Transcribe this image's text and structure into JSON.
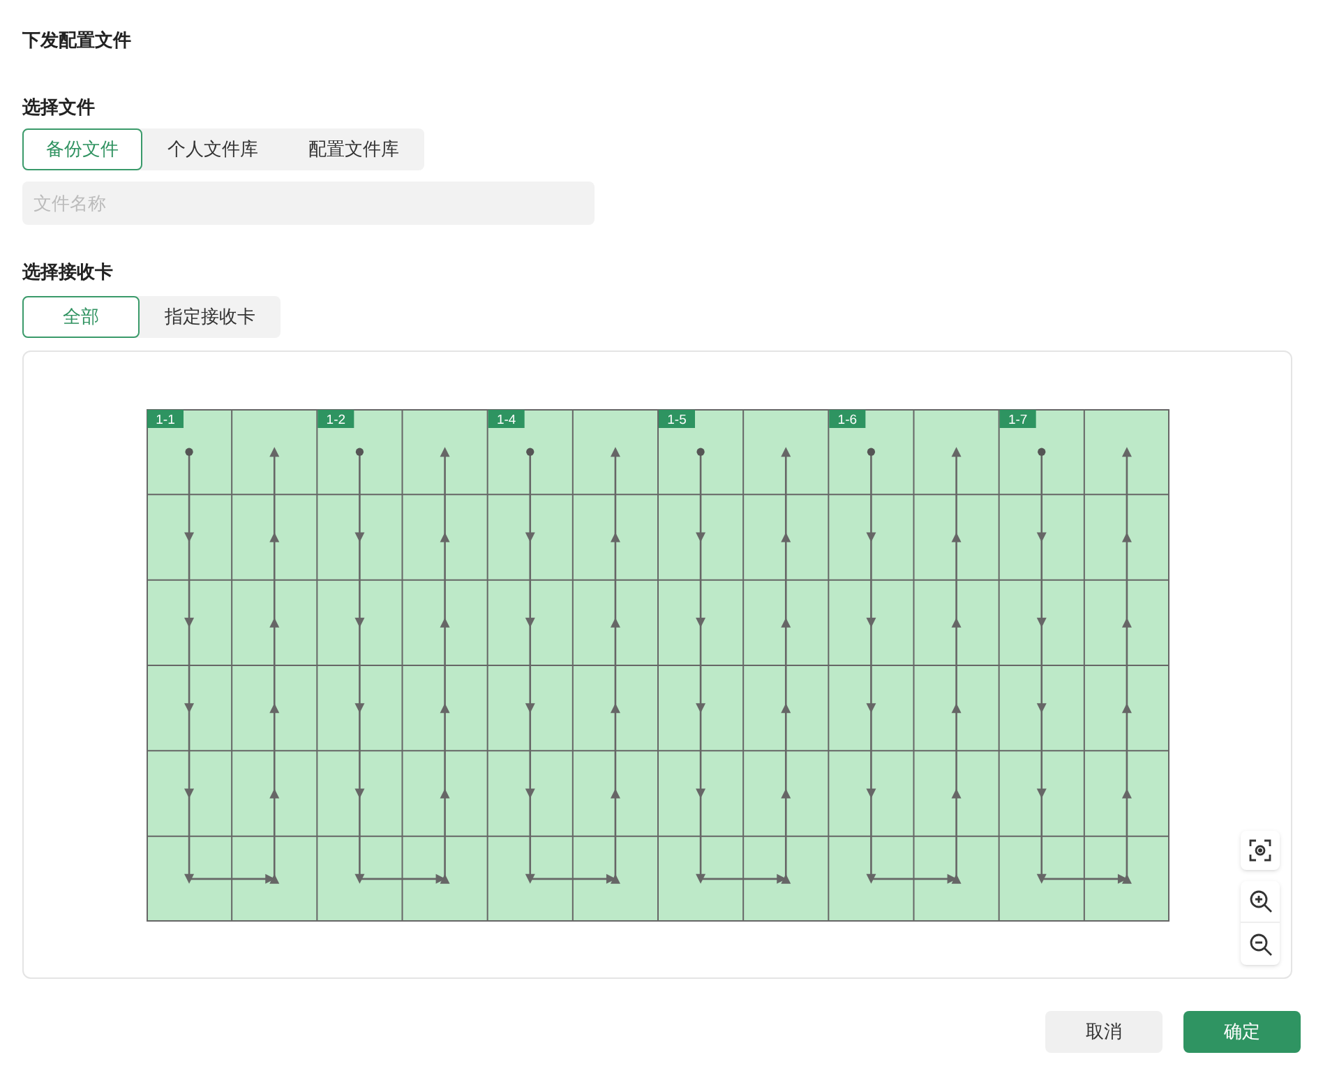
{
  "title": "下发配置文件",
  "file_section": {
    "label": "选择文件",
    "tabs": [
      {
        "label": "备份文件",
        "selected": true
      },
      {
        "label": "个人文件库",
        "selected": false
      },
      {
        "label": "配置文件库",
        "selected": false
      }
    ],
    "search": {
      "placeholder": "文件名称"
    }
  },
  "receiver_section": {
    "label": "选择接收卡",
    "tabs": [
      {
        "label": "全部",
        "selected": true
      },
      {
        "label": "指定接收卡",
        "selected": false
      }
    ],
    "cards": [
      {
        "label": "1-1"
      },
      {
        "label": "1-2"
      },
      {
        "label": "1-4"
      },
      {
        "label": "1-5"
      },
      {
        "label": "1-6"
      },
      {
        "label": "1-7"
      }
    ]
  },
  "buttons": [
    {
      "label": "取消",
      "kind": "secondary"
    },
    {
      "label": "确定",
      "kind": "primary"
    }
  ]
}
